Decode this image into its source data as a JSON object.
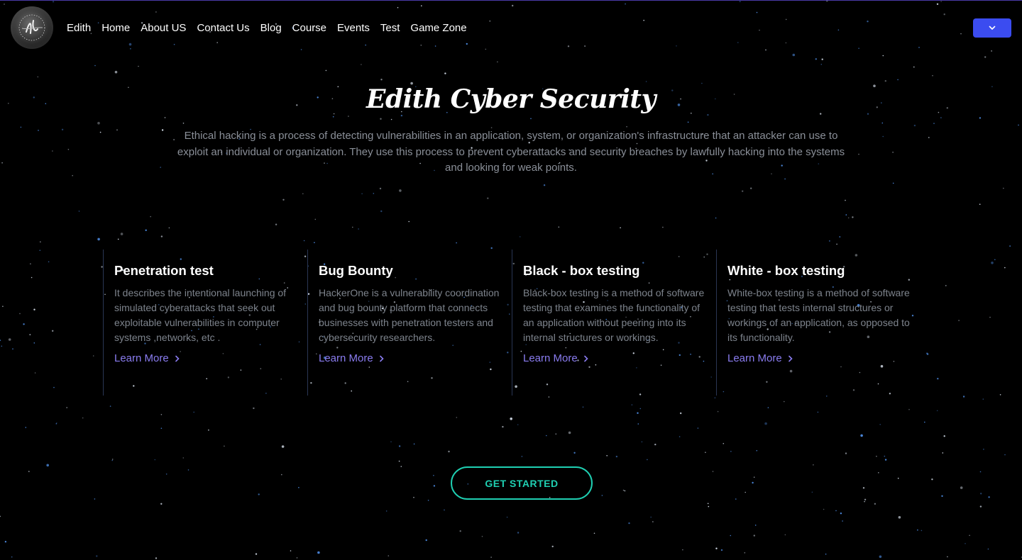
{
  "colors": {
    "background": "#000000",
    "accent_button": "#3b4cf0",
    "link": "#8a7cf0",
    "cta": "#1fcfb2",
    "muted_text": "#8a8f98"
  },
  "nav": {
    "logo_icon": "edith-logo-icon",
    "links": [
      "Edith",
      "Home",
      "About US",
      "Contact Us",
      "Blog",
      "Course",
      "Events",
      "Test",
      "Game Zone"
    ],
    "dropdown_icon": "chevron-down-icon"
  },
  "hero": {
    "title": "Edith Cyber Security",
    "description": "Ethical hacking is a process of detecting vulnerabilities in an application, system, or organization's infrastructure that an attacker can use to exploit an individual or organization. They use this process to prevent cyberattacks and security breaches by lawfully hacking into the systems and looking for weak points."
  },
  "cards": [
    {
      "title": "Penetration test",
      "text": "It describes the intentional launching of simulated cyberattacks that seek out exploitable vulnerabilities in computer systems ,networks, etc .",
      "link": "Learn More"
    },
    {
      "title": "Bug Bounty",
      "text": "HackerOne is a vulnerability coordination and bug bounty platform that connects businesses with penetration testers and cybersecurity researchers.",
      "link": "Learn More"
    },
    {
      "title": "Black - box testing",
      "text": "Black-box testing is a method of software testing that examines the functionality of an application without peering into its internal structures or workings.",
      "link": "Learn More"
    },
    {
      "title": "White - box testing",
      "text": "White-box testing is a method of software testing that tests internal structures or workings of an application, as opposed to its functionality.",
      "link": "Learn More"
    }
  ],
  "cta": {
    "label": "GET STARTED"
  }
}
